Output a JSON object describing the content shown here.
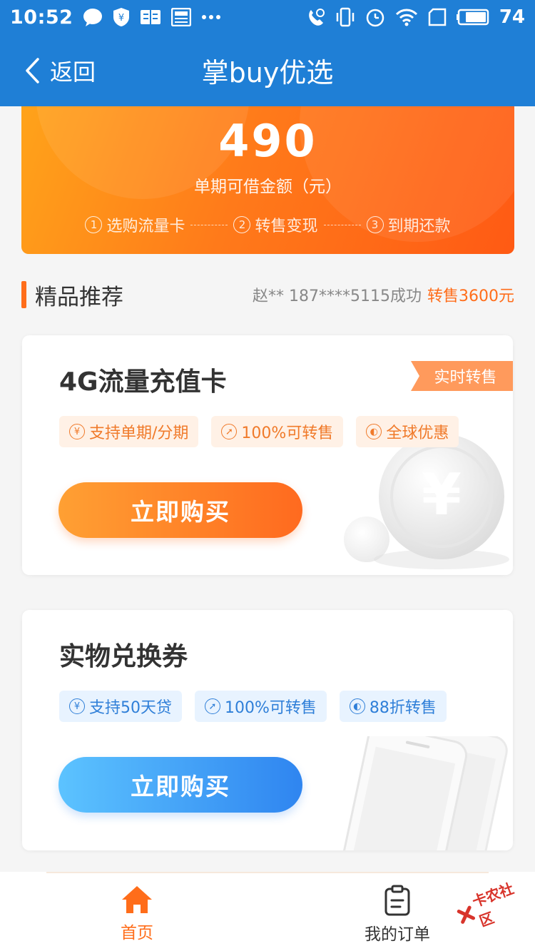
{
  "status_bar": {
    "time": "10:52",
    "icons": [
      "chat-bubble-icon",
      "shield-yen-icon",
      "book-icon",
      "news-icon",
      "more-dots-icon",
      "mute-icon",
      "vibrate-icon",
      "alarm-icon",
      "wifi-icon",
      "sim-icon",
      "battery-icon"
    ],
    "battery": "74"
  },
  "nav": {
    "back_label": "返回",
    "title": "掌buy优选"
  },
  "banner": {
    "amount": "490",
    "label": "单期可借金额（元）",
    "steps": [
      {
        "num": "1",
        "label": "选购流量卡"
      },
      {
        "num": "2",
        "label": "转售变现"
      },
      {
        "num": "3",
        "label": "到期还款"
      }
    ]
  },
  "section": {
    "title": "精品推荐",
    "ticker_text": "赵** 187****5115成功",
    "ticker_amount": "转售3600元"
  },
  "cards": [
    {
      "title": "4G流量充值卡",
      "ribbon": "实时转售",
      "tags": [
        {
          "icon": "yen-icon",
          "label": "支持单期/分期"
        },
        {
          "icon": "share-arrow-icon",
          "label": "100%可转售"
        },
        {
          "icon": "globe-icon",
          "label": "全球优惠"
        }
      ],
      "button": "立即购买"
    },
    {
      "title": "实物兑换券",
      "tags": [
        {
          "icon": "yen-icon",
          "label": "支持50天贷"
        },
        {
          "icon": "share-arrow-icon",
          "label": "100%可转售"
        },
        {
          "icon": "globe-icon",
          "label": "88折转售"
        }
      ],
      "button": "立即购买"
    }
  ],
  "tabs": [
    {
      "label": "首页",
      "icon": "home-icon",
      "active": true
    },
    {
      "label": "我的订单",
      "icon": "clipboard-icon",
      "active": false
    }
  ],
  "watermark": "卡农社区",
  "colors": {
    "primary_blue": "#1f7fd6",
    "accent_orange": "#ff6d1a",
    "tag_blue": "#2f7fd8"
  }
}
